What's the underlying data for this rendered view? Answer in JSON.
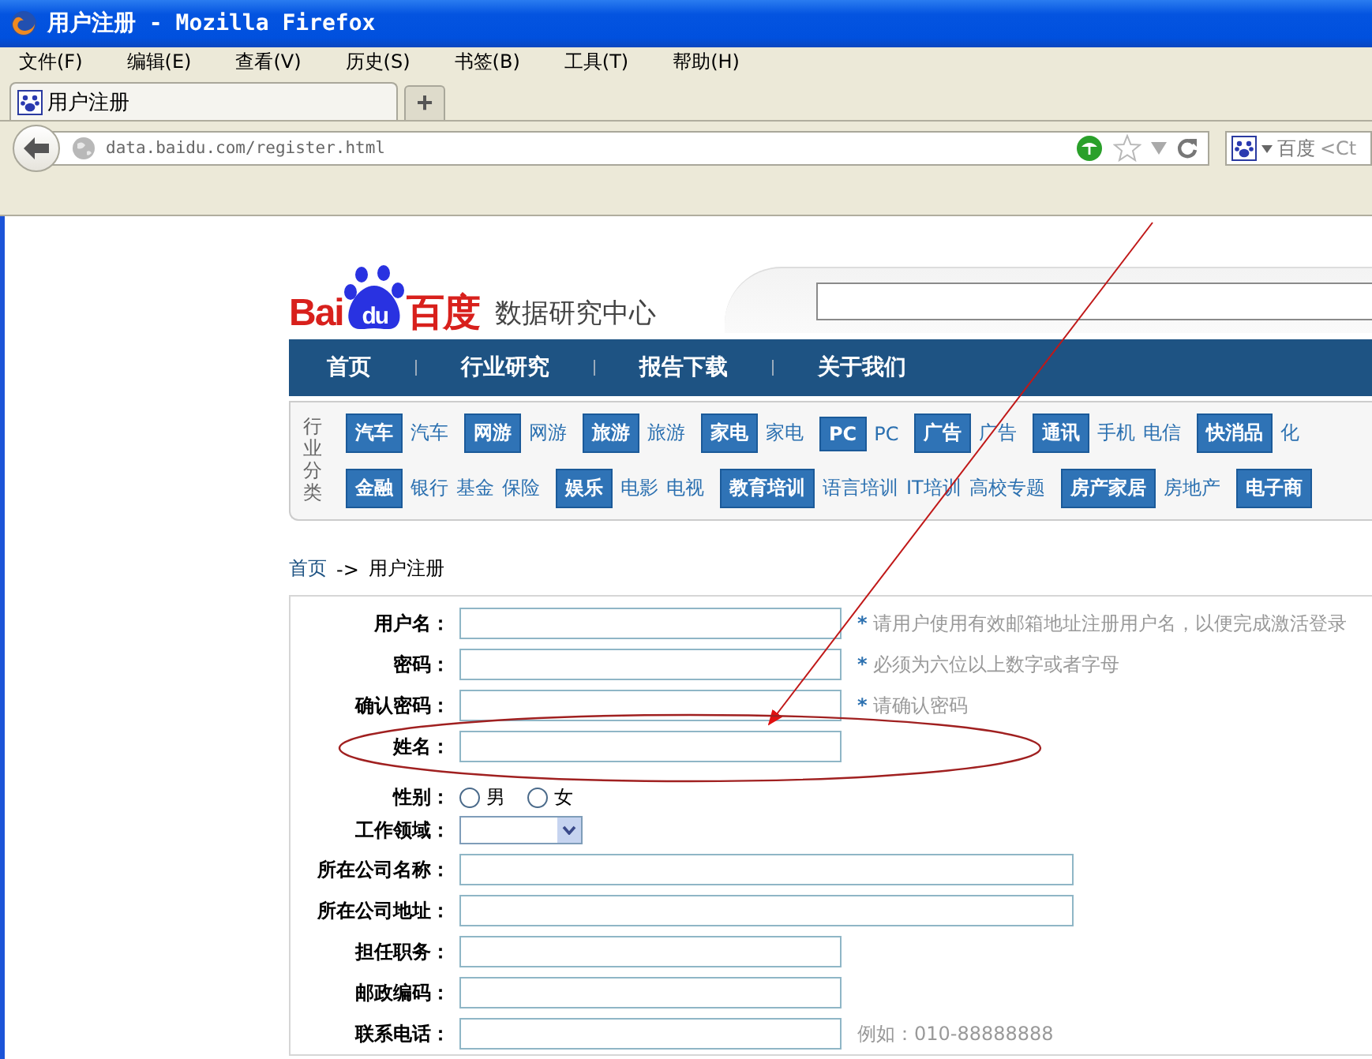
{
  "window": {
    "title": "用户注册 - Mozilla Firefox"
  },
  "menu": [
    "文件(F)",
    "编辑(E)",
    "查看(V)",
    "历史(S)",
    "书签(B)",
    "工具(T)",
    "帮助(H)"
  ],
  "tabs": [
    {
      "label": "用户注册",
      "selected": true
    }
  ],
  "new_tab": "+",
  "address_bar": {
    "value": "data.baidu.com/register.html"
  },
  "search_bar": {
    "engine": "百度",
    "placeholder": "<Ct"
  },
  "site": {
    "logo": {
      "left": "Bai",
      "paw": "du",
      "right": "百度"
    },
    "subtitle": "数据研究中心",
    "nav": [
      "首页",
      "行业研究",
      "报告下载",
      "关于我们"
    ],
    "category_label": "行业分类",
    "category_rows": [
      [
        {
          "text": "汽车",
          "kind": "tag"
        },
        {
          "text": "汽车",
          "kind": "link"
        },
        {
          "text": "网游",
          "kind": "tag"
        },
        {
          "text": "网游",
          "kind": "link"
        },
        {
          "text": "旅游",
          "kind": "tag"
        },
        {
          "text": "旅游",
          "kind": "link"
        },
        {
          "text": "家电",
          "kind": "tag"
        },
        {
          "text": "家电",
          "kind": "link"
        },
        {
          "text": "PC",
          "kind": "tag"
        },
        {
          "text": "PC",
          "kind": "link"
        },
        {
          "text": "广告",
          "kind": "tag"
        },
        {
          "text": "广告",
          "kind": "link"
        },
        {
          "text": "通讯",
          "kind": "tag"
        },
        {
          "text": "手机",
          "kind": "link"
        },
        {
          "text": "电信",
          "kind": "link"
        },
        {
          "text": "快消品",
          "kind": "tag"
        },
        {
          "text": "化",
          "kind": "link"
        }
      ],
      [
        {
          "text": "金融",
          "kind": "tag"
        },
        {
          "text": "银行",
          "kind": "link"
        },
        {
          "text": "基金",
          "kind": "link"
        },
        {
          "text": "保险",
          "kind": "link"
        },
        {
          "text": "娱乐",
          "kind": "tag"
        },
        {
          "text": "电影",
          "kind": "link"
        },
        {
          "text": "电视",
          "kind": "link"
        },
        {
          "text": "教育培训",
          "kind": "tag"
        },
        {
          "text": "语言培训",
          "kind": "link"
        },
        {
          "text": "IT培训",
          "kind": "link"
        },
        {
          "text": "高校专题",
          "kind": "link"
        },
        {
          "text": "房产家居",
          "kind": "tag"
        },
        {
          "text": "房地产",
          "kind": "link"
        },
        {
          "text": "电子商",
          "kind": "tag"
        }
      ]
    ]
  },
  "breadcrumb": {
    "home": "首页",
    "separator": "->",
    "current": "用户注册"
  },
  "form": [
    {
      "label": "用户名：",
      "kind": "text",
      "required_mark": "*",
      "hint": "请用户使用有效邮箱地址注册用户名，以便完成激活登录"
    },
    {
      "label": "密码：",
      "kind": "text",
      "required_mark": "*",
      "hint": "必须为六位以上数字或者字母"
    },
    {
      "label": "确认密码：",
      "kind": "text",
      "required_mark": "*",
      "hint": "请确认密码"
    },
    {
      "label": "姓名：",
      "kind": "text"
    },
    {
      "label": "性别：",
      "kind": "radio",
      "options": [
        {
          "label": "男",
          "selected": false
        },
        {
          "label": "女",
          "selected": false
        }
      ]
    },
    {
      "label": "工作领域：",
      "kind": "select"
    },
    {
      "label": "所在公司名称：",
      "kind": "wide"
    },
    {
      "label": "所在公司地址：",
      "kind": "wide"
    },
    {
      "label": "担任职务：",
      "kind": "text"
    },
    {
      "label": "邮政编码：",
      "kind": "text"
    },
    {
      "label": "联系电话：",
      "kind": "text",
      "example": "例如：010-88888888"
    }
  ]
}
